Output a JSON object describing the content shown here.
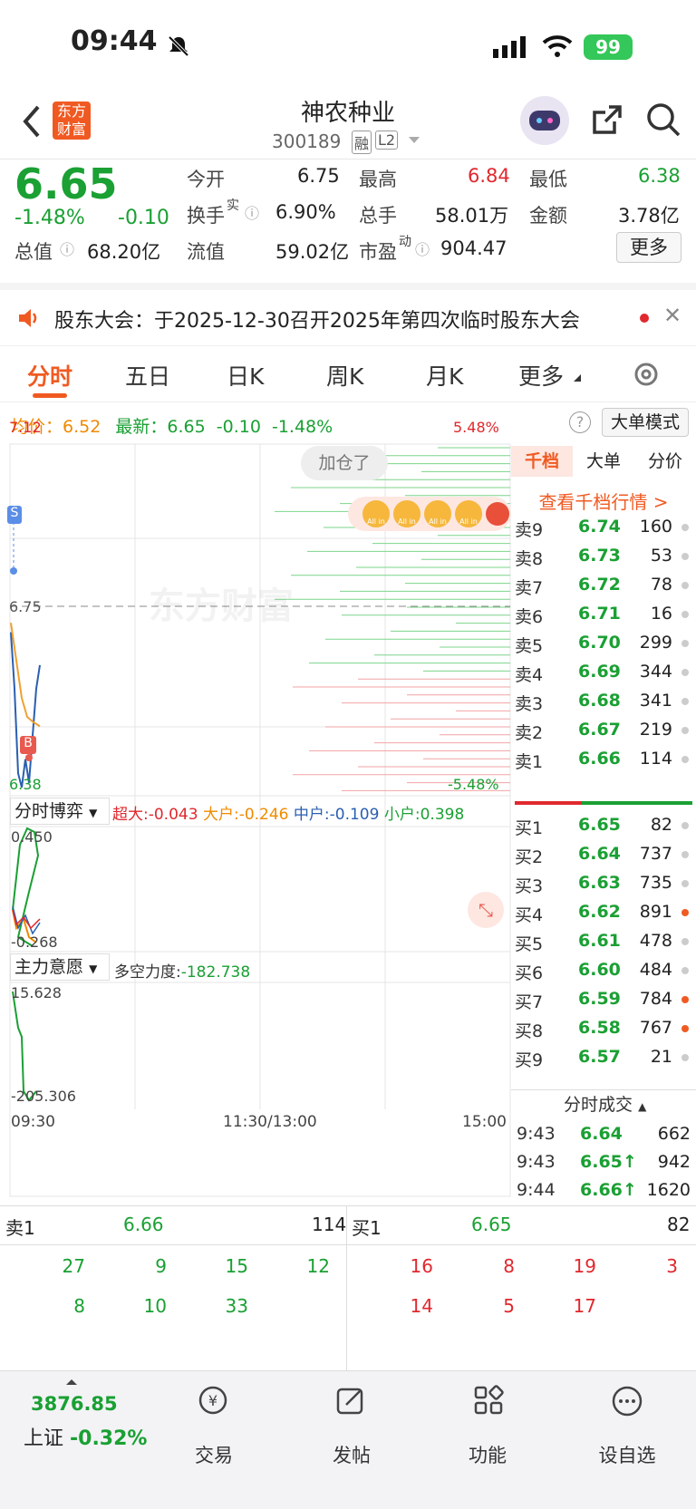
{
  "status": {
    "time": "09:44",
    "battery": "99"
  },
  "header": {
    "logo_line1": "东方",
    "logo_line2": "财富",
    "title": "神农种业",
    "code": "300189",
    "badge1": "融",
    "badge2": "L2"
  },
  "quote": {
    "price": "6.65",
    "change_pct": "-1.48%",
    "change": "-0.10",
    "fields": [
      {
        "label": "今开",
        "value": "6.75"
      },
      {
        "label": "最高",
        "value": "6.84"
      },
      {
        "label": "最低",
        "value": "6.38"
      },
      {
        "label": "换手",
        "sup": "实",
        "value": "6.90%"
      },
      {
        "label": "总手",
        "value": "58.01万"
      },
      {
        "label": "金额",
        "value": "3.78亿"
      },
      {
        "label": "总值",
        "value": "68.20亿"
      },
      {
        "label": "流值",
        "value": "59.02亿"
      },
      {
        "label": "市盈",
        "sup": "动",
        "value": "904.47"
      }
    ],
    "more": "更多"
  },
  "notice": {
    "text": "股东大会：于2025-12-30召开2025年第四次临时股东大会"
  },
  "tabs": [
    "分时",
    "五日",
    "日K",
    "周K",
    "月K",
    "更多"
  ],
  "chart": {
    "avg_label": "均价：",
    "avg": "6.52",
    "latest_label": "最新：",
    "latest": "6.65",
    "latest_chg": "-0.10",
    "latest_pct": "-1.48%",
    "bigmode": "大单模式",
    "y_high": "7.12",
    "y_open": "6.75",
    "y_low": "6.38",
    "pct_high": "5.48%",
    "pct_low": "-5.48%",
    "bubble": "加仓了",
    "watermark": "东方财富",
    "s_mark": "S",
    "b_mark": "B",
    "allin": "All in",
    "ind1": {
      "name": "分时博弈",
      "super_label": "超大:",
      "super": "-0.043",
      "big_label": "大户:",
      "big": "-0.246",
      "mid_label": "中户:",
      "mid": "-0.109",
      "small_label": "小户:",
      "small": "0.398",
      "top": "0.450",
      "bottom": "-0.268"
    },
    "ind2": {
      "name": "主力意愿",
      "label": "多空力度:",
      "value": "-182.738",
      "top": "15.628",
      "bottom": "-205.306"
    },
    "x_start": "09:30",
    "x_mid": "11:30/13:00",
    "x_end": "15:00"
  },
  "chart_data": {
    "type": "line",
    "x": [
      "09:30",
      "11:30/13:00",
      "15:00"
    ],
    "ylim": [
      6.38,
      7.12
    ],
    "reference": 6.75,
    "series": [
      {
        "name": "最新",
        "values": [
          6.65
        ]
      },
      {
        "name": "均价",
        "values": [
          6.52
        ]
      }
    ]
  },
  "depth": {
    "tabs": [
      "千档",
      "大单",
      "分价"
    ],
    "link": "查看千档行情 >",
    "asks": [
      {
        "label": "卖9",
        "price": "6.74",
        "vol": "160"
      },
      {
        "label": "卖8",
        "price": "6.73",
        "vol": "53"
      },
      {
        "label": "卖7",
        "price": "6.72",
        "vol": "78"
      },
      {
        "label": "卖6",
        "price": "6.71",
        "vol": "16"
      },
      {
        "label": "卖5",
        "price": "6.70",
        "vol": "299"
      },
      {
        "label": "卖4",
        "price": "6.69",
        "vol": "344"
      },
      {
        "label": "卖3",
        "price": "6.68",
        "vol": "341"
      },
      {
        "label": "卖2",
        "price": "6.67",
        "vol": "219"
      },
      {
        "label": "卖1",
        "price": "6.66",
        "vol": "114"
      }
    ],
    "bids": [
      {
        "label": "买1",
        "price": "6.65",
        "vol": "82"
      },
      {
        "label": "买2",
        "price": "6.64",
        "vol": "737"
      },
      {
        "label": "买3",
        "price": "6.63",
        "vol": "735"
      },
      {
        "label": "买4",
        "price": "6.62",
        "vol": "891"
      },
      {
        "label": "买5",
        "price": "6.61",
        "vol": "478"
      },
      {
        "label": "买6",
        "price": "6.60",
        "vol": "484"
      },
      {
        "label": "买7",
        "price": "6.59",
        "vol": "784"
      },
      {
        "label": "买8",
        "price": "6.58",
        "vol": "767"
      },
      {
        "label": "买9",
        "price": "6.57",
        "vol": "21"
      }
    ],
    "trades_title": "分时成交",
    "trades": [
      {
        "t": "9:43",
        "p": "6.64",
        "v": "662"
      },
      {
        "t": "9:43",
        "p": "6.65↑",
        "v": "942"
      },
      {
        "t": "9:44",
        "p": "6.66↑",
        "v": "1620"
      }
    ]
  },
  "queue": {
    "sell_label": "卖1",
    "sell_price": "6.66",
    "sell_vol": "114",
    "buy_label": "买1",
    "buy_price": "6.65",
    "buy_vol": "82",
    "sell_row1": [
      "27",
      "9",
      "15",
      "12"
    ],
    "sell_row2": [
      "8",
      "10",
      "33"
    ],
    "buy_row1": [
      "16",
      "8",
      "19",
      "3"
    ],
    "buy_row2": [
      "14",
      "5",
      "17"
    ]
  },
  "nav": {
    "index_value": "3876.85",
    "index_name": "上证",
    "index_pct": "-0.32%",
    "items": [
      "交易",
      "发帖",
      "功能",
      "设自选"
    ]
  }
}
